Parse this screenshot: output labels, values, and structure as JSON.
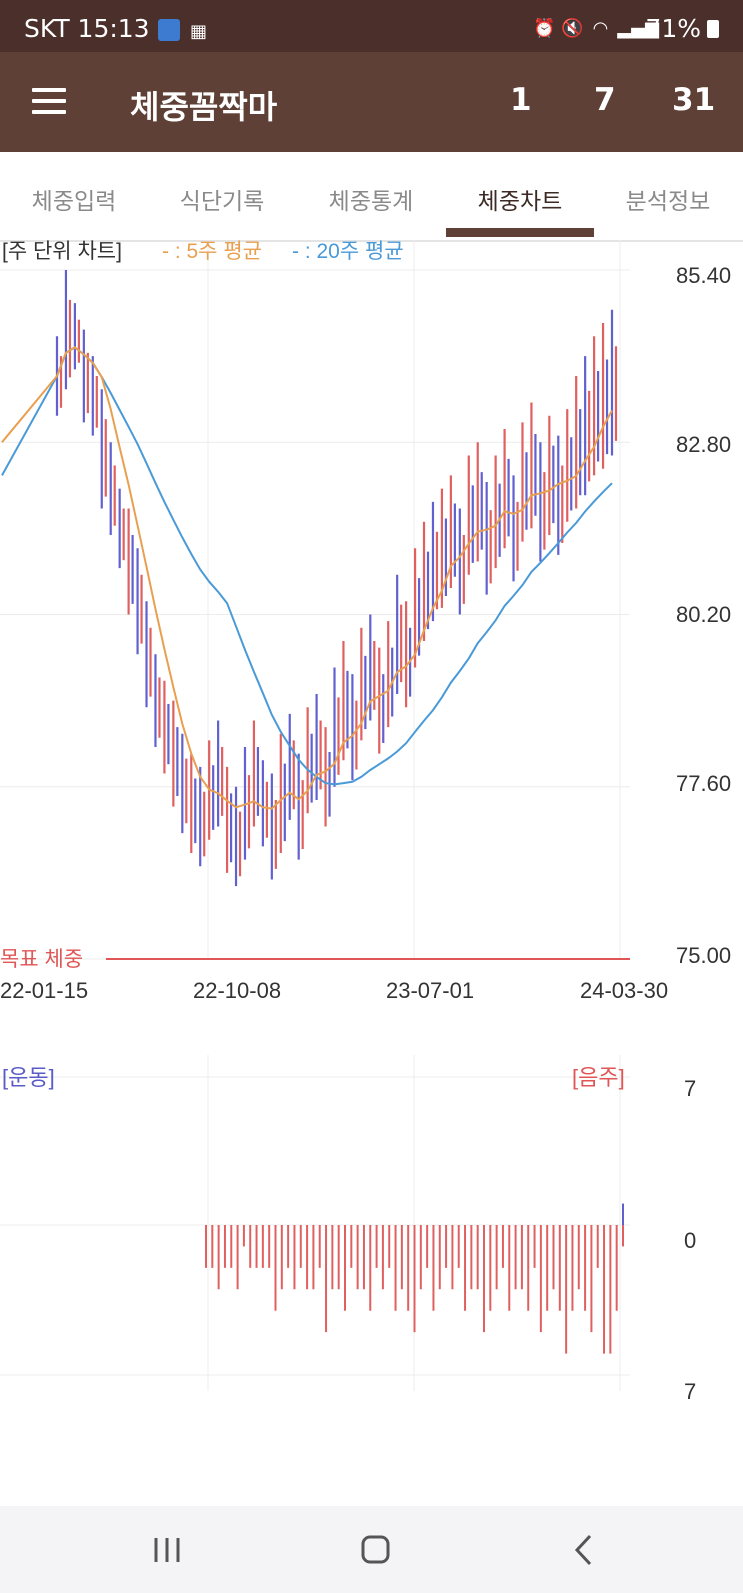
{
  "status_bar": {
    "carrier": "SKT",
    "time": "15:13",
    "battery": "71%",
    "icons": [
      "alarm-icon",
      "mute-icon",
      "wifi-icon",
      "signal-icon",
      "battery-icon"
    ]
  },
  "app_bar": {
    "title": "체중꼼짝마",
    "counters": [
      "1",
      "7",
      "31"
    ]
  },
  "tabs": [
    {
      "label": "체중입력"
    },
    {
      "label": "식단기록"
    },
    {
      "label": "체중통계"
    },
    {
      "label": "체중차트",
      "active": true
    },
    {
      "label": "분석정보"
    }
  ],
  "weight_chart": {
    "title": "[주 단위 차트]",
    "legend_5": "- : 5주 평균",
    "legend_20": "- : 20주 평균",
    "goal_label": "목표 체중",
    "y_labels": [
      "85.40",
      "82.80",
      "80.20",
      "77.60",
      "75.00"
    ],
    "x_labels": [
      "22-01-15",
      "22-10-08",
      "23-07-01",
      "24-03-30"
    ]
  },
  "activity_chart": {
    "left_label": "[운동]",
    "right_label": "[음주]",
    "y_labels": [
      "7",
      "0",
      "7"
    ]
  },
  "chart_data": [
    {
      "type": "candlestick",
      "title": "[주 단위 차트]",
      "x_start": "22-01-15",
      "x_end": "24-03-30",
      "ylim": [
        75.0,
        85.4
      ],
      "y_ticks": [
        85.4,
        82.8,
        80.2,
        77.6,
        75.0
      ],
      "goal_weight": 75.0,
      "goal_label": "목표 체중",
      "up_color": "#e06060",
      "down_color": "#6060d0",
      "weekly_ranges": [
        [
          83.2,
          84.4,
          "d"
        ],
        [
          83.6,
          85.4,
          "d"
        ],
        [
          83.9,
          84.9,
          "d"
        ],
        [
          83.1,
          84.5,
          "d"
        ],
        [
          82.9,
          84.1,
          "d"
        ],
        [
          81.8,
          83.6,
          "d"
        ],
        [
          81.4,
          82.8,
          "d"
        ],
        [
          80.9,
          82.1,
          "d"
        ],
        [
          80.2,
          81.8,
          "u"
        ],
        [
          79.6,
          81.2,
          "d"
        ],
        [
          78.8,
          80.4,
          "d"
        ],
        [
          78.2,
          79.6,
          "d"
        ],
        [
          77.8,
          79.2,
          "u"
        ],
        [
          77.3,
          78.9,
          "u"
        ],
        [
          76.9,
          78.4,
          "d"
        ],
        [
          76.6,
          78.1,
          "u"
        ],
        [
          76.4,
          77.9,
          "d"
        ],
        [
          76.8,
          78.3,
          "u"
        ],
        [
          77.0,
          78.6,
          "d"
        ],
        [
          76.3,
          77.9,
          "u"
        ],
        [
          76.1,
          77.6,
          "d"
        ],
        [
          76.5,
          78.2,
          "d"
        ],
        [
          77.0,
          78.6,
          "u"
        ],
        [
          76.7,
          78.0,
          "d"
        ],
        [
          76.2,
          77.8,
          "d"
        ],
        [
          76.6,
          78.4,
          "u"
        ],
        [
          77.1,
          78.7,
          "d"
        ],
        [
          76.5,
          78.1,
          "d"
        ],
        [
          77.2,
          78.8,
          "u"
        ],
        [
          77.4,
          79.0,
          "d"
        ],
        [
          77.0,
          78.5,
          "u"
        ],
        [
          77.6,
          79.4,
          "d"
        ],
        [
          78.0,
          79.8,
          "u"
        ],
        [
          77.7,
          79.3,
          "d"
        ],
        [
          78.3,
          80.0,
          "u"
        ],
        [
          78.6,
          80.2,
          "d"
        ],
        [
          78.1,
          79.7,
          "u"
        ],
        [
          78.5,
          80.1,
          "u"
        ],
        [
          79.0,
          80.8,
          "d"
        ],
        [
          78.8,
          80.4,
          "u"
        ],
        [
          79.4,
          81.2,
          "u"
        ],
        [
          79.8,
          81.6,
          "u"
        ],
        [
          80.1,
          81.9,
          "d"
        ],
        [
          80.3,
          82.1,
          "u"
        ],
        [
          80.6,
          82.3,
          "u"
        ],
        [
          80.2,
          81.8,
          "d"
        ],
        [
          80.8,
          82.6,
          "u"
        ],
        [
          81.0,
          82.8,
          "u"
        ],
        [
          80.5,
          82.2,
          "d"
        ],
        [
          80.9,
          82.6,
          "u"
        ],
        [
          81.2,
          83.0,
          "u"
        ],
        [
          80.7,
          82.3,
          "d"
        ],
        [
          81.3,
          83.1,
          "u"
        ],
        [
          81.5,
          83.4,
          "u"
        ],
        [
          81.0,
          82.8,
          "d"
        ],
        [
          81.4,
          83.2,
          "u"
        ],
        [
          81.1,
          82.9,
          "d"
        ],
        [
          81.6,
          83.3,
          "u"
        ],
        [
          81.8,
          83.8,
          "u"
        ],
        [
          82.0,
          84.1,
          "d"
        ],
        [
          82.3,
          84.4,
          "u"
        ],
        [
          82.4,
          84.6,
          "u"
        ],
        [
          82.6,
          84.8,
          "d"
        ]
      ]
    },
    {
      "type": "bar",
      "title": "",
      "left_label": "[운동]",
      "right_label": "[음주]",
      "ylim": [
        -7,
        7
      ],
      "note": "weekly drinking counts shown as downward bars, exercise as upward bars",
      "drinking": [
        2,
        2,
        3,
        2,
        2,
        3,
        1,
        2,
        2,
        2,
        2,
        4,
        3,
        2,
        3,
        2,
        3,
        3,
        2,
        5,
        3,
        3,
        4,
        2,
        3,
        3,
        4,
        2,
        3,
        2,
        4,
        3,
        4,
        5,
        3,
        2,
        4,
        3,
        2,
        3,
        2,
        4,
        3,
        3,
        5,
        4,
        3,
        2,
        4,
        3,
        3,
        4,
        2,
        5,
        4,
        3,
        4,
        6,
        4,
        3,
        4,
        5,
        2,
        6,
        6,
        4,
        1
      ],
      "exercise": [
        0,
        0,
        0,
        0,
        0,
        0,
        0,
        0,
        0,
        0,
        0,
        0,
        0,
        0,
        0,
        0,
        0,
        0,
        0,
        0,
        0,
        0,
        0,
        0,
        0,
        0,
        0,
        0,
        0,
        0,
        0,
        0,
        0,
        0,
        0,
        0,
        0,
        0,
        0,
        0,
        0,
        0,
        0,
        0,
        0,
        0,
        0,
        0,
        0,
        0,
        0,
        0,
        0,
        0,
        0,
        0,
        0,
        0,
        0,
        0,
        0,
        0,
        0,
        0,
        0,
        0,
        1
      ]
    }
  ],
  "nav_bar": {
    "icons": [
      "recent-apps-icon",
      "home-icon",
      "back-icon"
    ]
  }
}
